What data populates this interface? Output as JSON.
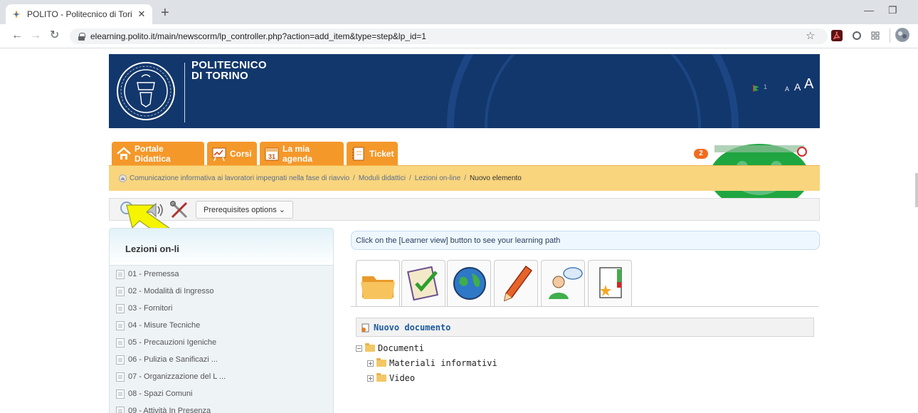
{
  "browser": {
    "tab_title": "POLITO - Politecnico di Torino - P",
    "url": "elearning.polito.it/main/newscorm/lp_controller.php?action=add_item&type=step&lp_id=1"
  },
  "header": {
    "institution_name": "POLITECNICO\nDI TORINO",
    "flag_count": "1",
    "font_small": "A",
    "font_medium": "A",
    "font_large": "A"
  },
  "nav": {
    "tabs": [
      {
        "label": "Portale Didattica"
      },
      {
        "label": "Corsi"
      },
      {
        "label": "La mia agenda"
      },
      {
        "label": "Ticket"
      }
    ],
    "calendar_day": "31",
    "notification_count": "2"
  },
  "breadcrumb": {
    "items": [
      "Comunicazione informativa ai lavoratori impegnati nella fase di riavvio",
      "Moduli didattici",
      "Lezioni on-line"
    ],
    "current": "Nuovo elemento",
    "separator": "/"
  },
  "actions": {
    "prerequisites_label": "Prerequisites options ⌄"
  },
  "sidebar": {
    "title": "Lezioni on-li",
    "lessons": [
      "01 - Premessa",
      "02 - Modalità di Ingresso",
      "03 - Fornitori",
      "04 - Misure Tecniche",
      "05 - Precauzioni Igeniche",
      "06 - Pulizia e Sanificazi ...",
      "07 - Organizzazione del L ...",
      "08 - Spazi Comuni",
      "09 - Attività In Presenza"
    ]
  },
  "main": {
    "info_text": "Click on the [Learner view] button to see your learning path",
    "new_document_label": "Nuovo documento",
    "tree": {
      "root": "Documenti",
      "children": [
        "Materiali informativi",
        "Video"
      ]
    }
  },
  "colors": {
    "banner": "#12376c",
    "nav_tab": "#f5982a",
    "breadcrumb": "#f9d57e",
    "annotation_arrow": "#f5f500"
  }
}
